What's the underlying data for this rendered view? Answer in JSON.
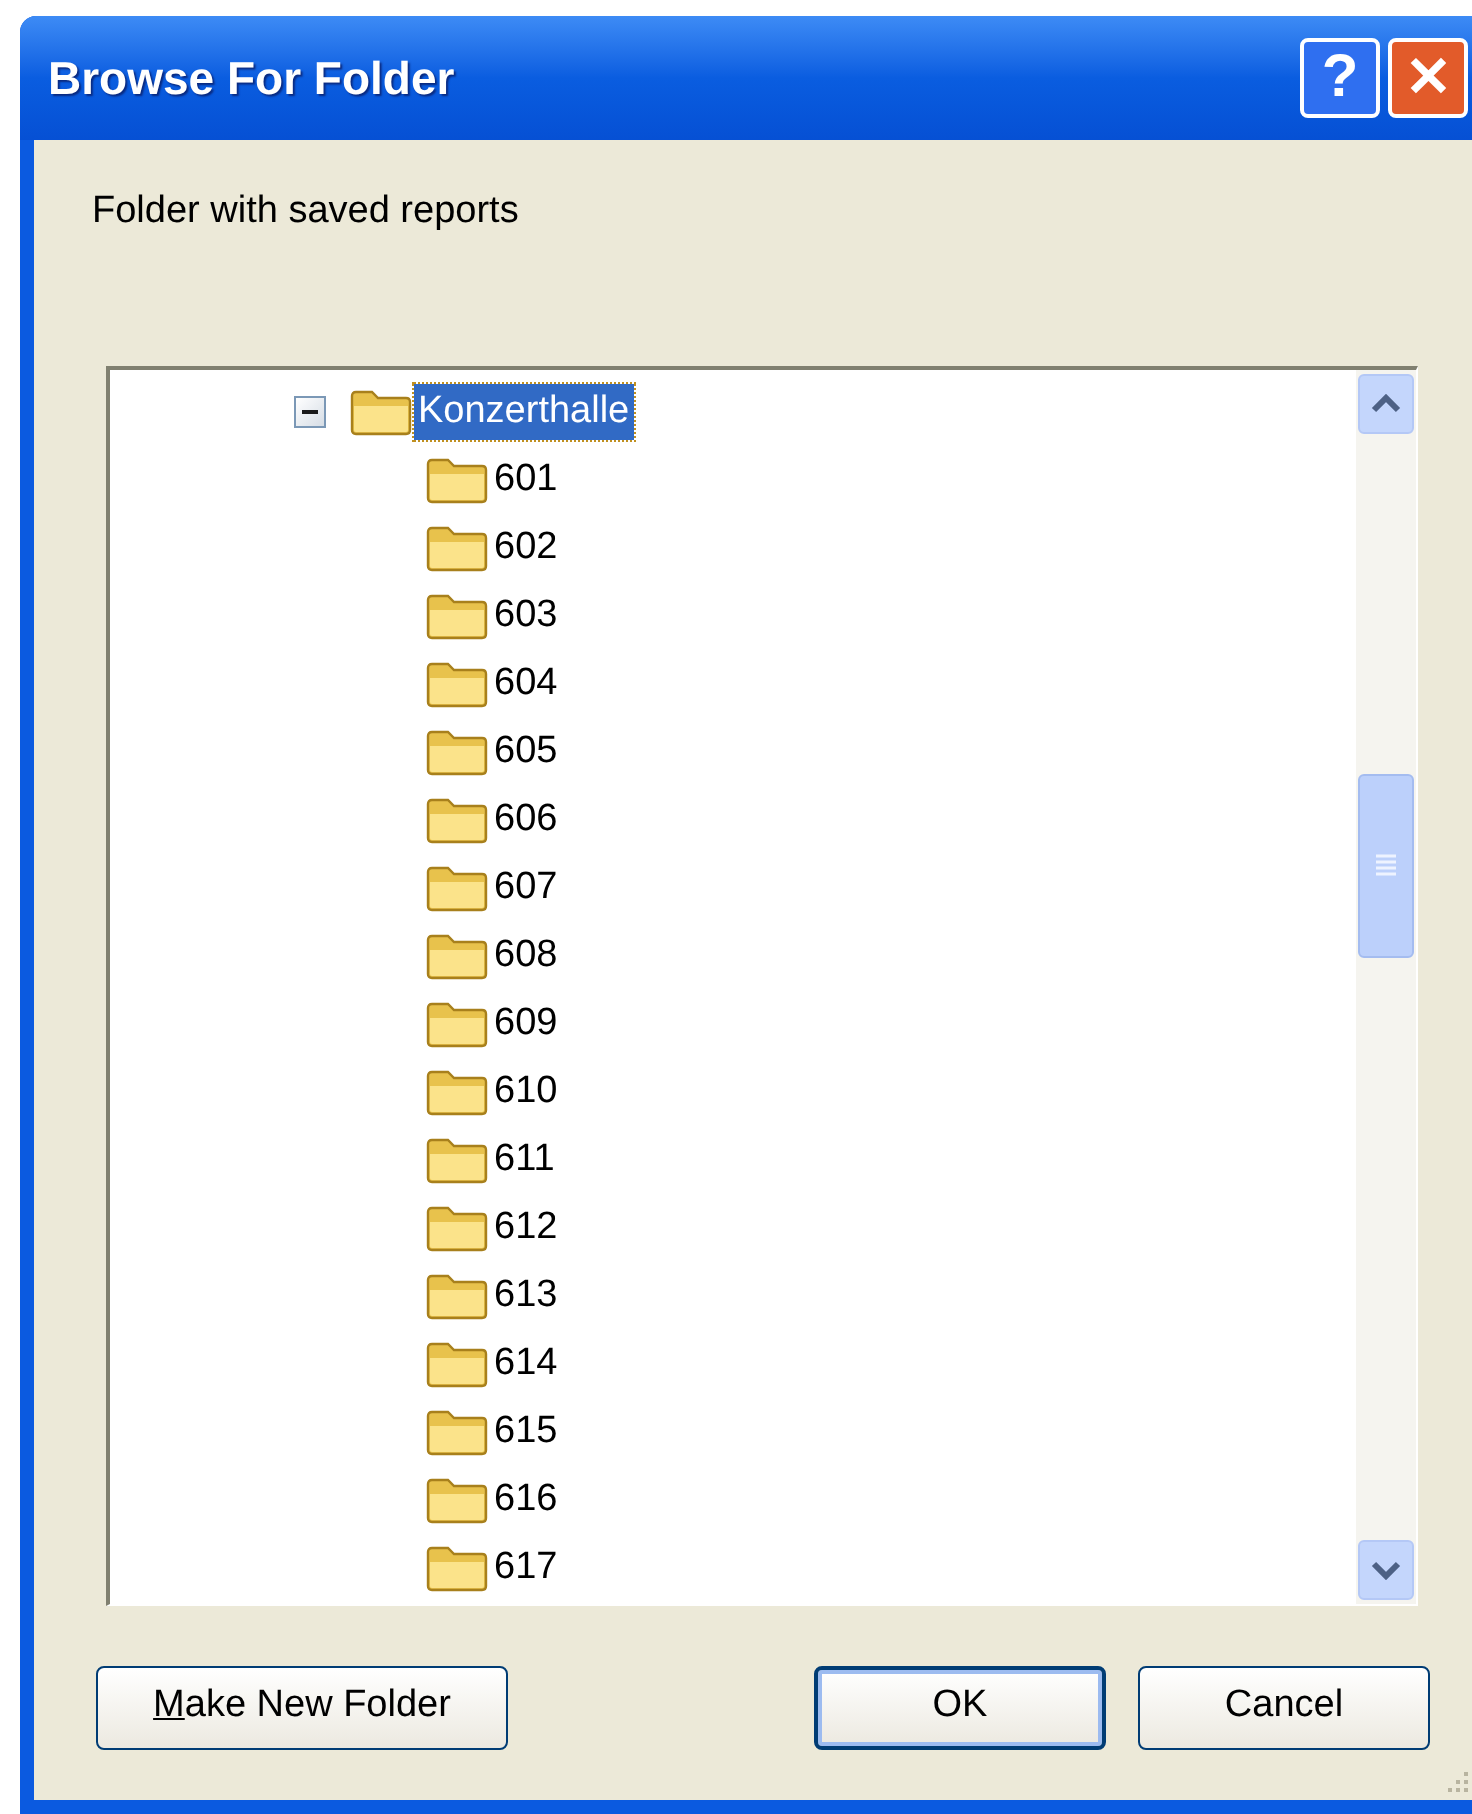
{
  "window": {
    "title": "Browse For Folder"
  },
  "title_buttons": [
    {
      "kind": "help",
      "label": "?"
    },
    {
      "kind": "close",
      "label": "✕"
    }
  ],
  "prompt": "Folder with saved reports",
  "tree": [
    {
      "label": "Konzerthalle",
      "expanded": true,
      "selected": true,
      "children": [
        {
          "label": "601",
          "selected": false
        },
        {
          "label": "602",
          "selected": false
        },
        {
          "label": "603",
          "selected": false
        },
        {
          "label": "604",
          "selected": false
        },
        {
          "label": "605",
          "selected": false
        },
        {
          "label": "606",
          "selected": false
        },
        {
          "label": "607",
          "selected": false
        },
        {
          "label": "608",
          "selected": false
        },
        {
          "label": "609",
          "selected": false
        },
        {
          "label": "610",
          "selected": false
        },
        {
          "label": "611",
          "selected": false
        },
        {
          "label": "612",
          "selected": false
        },
        {
          "label": "613",
          "selected": false
        },
        {
          "label": "614",
          "selected": false
        },
        {
          "label": "615",
          "selected": false
        },
        {
          "label": "616",
          "selected": false
        },
        {
          "label": "617",
          "selected": false
        }
      ]
    }
  ],
  "buttons": [
    {
      "label_parts": [
        {
          "text": "M",
          "underlined": true
        },
        {
          "text": "ake New Folder",
          "underlined": false
        }
      ],
      "default": false
    },
    {
      "label": "OK",
      "default": true
    },
    {
      "label": "Cancel",
      "default": false
    }
  ]
}
